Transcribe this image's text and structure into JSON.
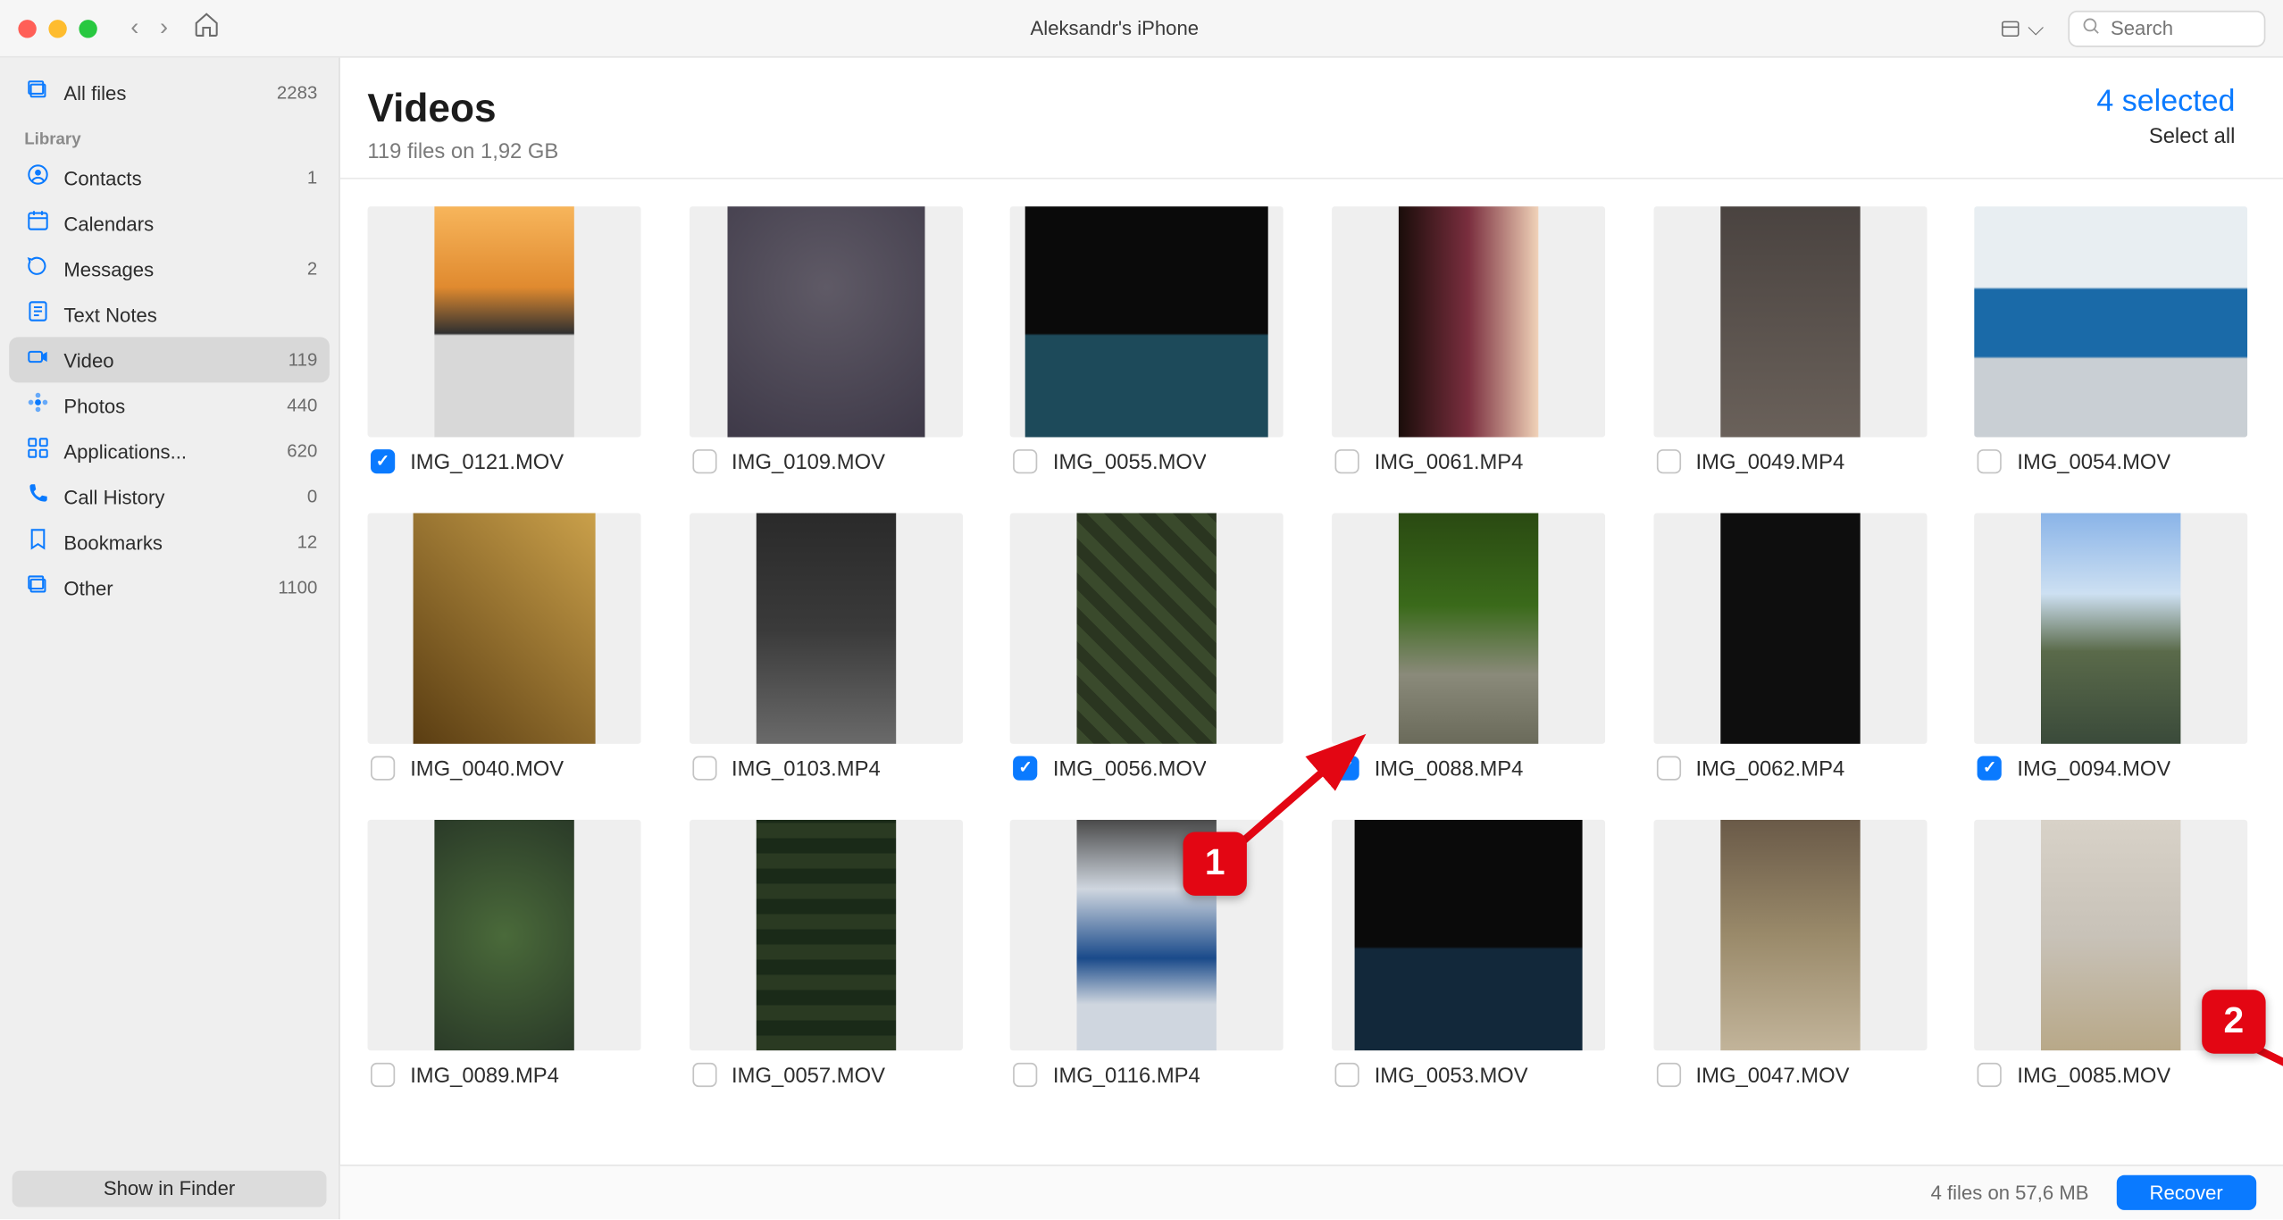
{
  "titlebar": {
    "title": "Aleksandr's iPhone",
    "search_placeholder": "Search"
  },
  "sidebar": {
    "top": {
      "label": "All files",
      "count": "2283"
    },
    "section_label": "Library",
    "items": [
      {
        "icon": "contacts",
        "label": "Contacts",
        "count": "1"
      },
      {
        "icon": "calendar",
        "label": "Calendars",
        "count": ""
      },
      {
        "icon": "messages",
        "label": "Messages",
        "count": "2"
      },
      {
        "icon": "notes",
        "label": "Text Notes",
        "count": ""
      },
      {
        "icon": "video",
        "label": "Video",
        "count": "119",
        "selected": true
      },
      {
        "icon": "photos",
        "label": "Photos",
        "count": "440"
      },
      {
        "icon": "apps",
        "label": "Applications...",
        "count": "620"
      },
      {
        "icon": "calls",
        "label": "Call History",
        "count": "0"
      },
      {
        "icon": "bookmarks",
        "label": "Bookmarks",
        "count": "12"
      },
      {
        "icon": "other",
        "label": "Other",
        "count": "1100"
      }
    ],
    "footer_button": "Show in Finder"
  },
  "main": {
    "title": "Videos",
    "subtitle": "119 files on 1,92 GB",
    "selected_text": "4 selected",
    "select_all": "Select all",
    "items": [
      {
        "name": "IMG_0121.MOV",
        "checked": true
      },
      {
        "name": "IMG_0109.MOV",
        "checked": false
      },
      {
        "name": "IMG_0055.MOV",
        "checked": false
      },
      {
        "name": "IMG_0061.MP4",
        "checked": false
      },
      {
        "name": "IMG_0049.MP4",
        "checked": false
      },
      {
        "name": "IMG_0054.MOV",
        "checked": false
      },
      {
        "name": "IMG_0040.MOV",
        "checked": false
      },
      {
        "name": "IMG_0103.MP4",
        "checked": false
      },
      {
        "name": "IMG_0056.MOV",
        "checked": true
      },
      {
        "name": "IMG_0088.MP4",
        "checked": true
      },
      {
        "name": "IMG_0062.MP4",
        "checked": false
      },
      {
        "name": "IMG_0094.MOV",
        "checked": true
      },
      {
        "name": "IMG_0089.MP4",
        "checked": false
      },
      {
        "name": "IMG_0057.MOV",
        "checked": false
      },
      {
        "name": "IMG_0116.MP4",
        "checked": false
      },
      {
        "name": "IMG_0053.MOV",
        "checked": false
      },
      {
        "name": "IMG_0047.MOV",
        "checked": false
      },
      {
        "name": "IMG_0085.MOV",
        "checked": false
      }
    ]
  },
  "footer": {
    "status": "4 files on 57,6 MB",
    "recover_label": "Recover"
  },
  "annotations": {
    "badge1": "1",
    "badge2": "2"
  },
  "icons": {
    "contacts": "◉",
    "calendar": "▦",
    "messages": "💬",
    "notes": "▤",
    "video": "■",
    "photos": "✱",
    "apps": "▣",
    "calls": "✆",
    "bookmarks": "⟟",
    "other": "▭",
    "allfiles": "▭"
  }
}
